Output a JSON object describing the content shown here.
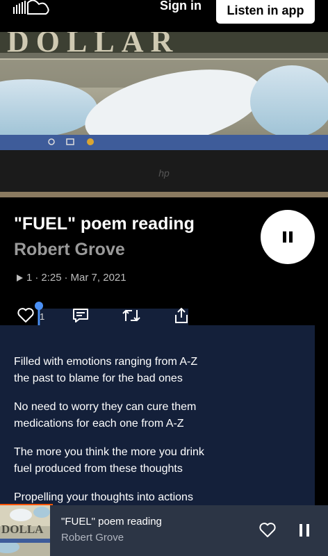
{
  "topbar": {
    "logo_icon": "soundcloud-logo-icon",
    "signin_label": "Sign in",
    "listen_label": "Listen in app"
  },
  "artwork": {
    "banner_text": "DOLLAR",
    "laptop_brand": "hp"
  },
  "track": {
    "title": "\"FUEL\" poem reading",
    "artist": "Robert Grove",
    "plays": "1",
    "duration": "2:25",
    "date": "Mar 7, 2021",
    "separator": "·"
  },
  "actions": {
    "like_count": "1",
    "icons": [
      "heart-icon",
      "comment-icon",
      "repost-icon",
      "share-icon"
    ]
  },
  "description": {
    "paragraphs": [
      [
        "Filled with emotions ranging from A-Z",
        "the past to blame for the bad ones"
      ],
      [
        "No need to worry they can cure them",
        "medications for each one from A-Z"
      ],
      [
        "The more you think the more you drink",
        "fuel produced from these thoughts"
      ],
      [
        "Propelling your thoughts into actions",
        ""
      ]
    ]
  },
  "mini_player": {
    "title": "\"FUEL\" poem reading",
    "artist": "Robert Grove",
    "artwork_text": "DOLLA",
    "progress": 0.16
  },
  "colors": {
    "accent": "#ff5500",
    "panel": "#14203a",
    "mini_bg": "#2c3545"
  }
}
